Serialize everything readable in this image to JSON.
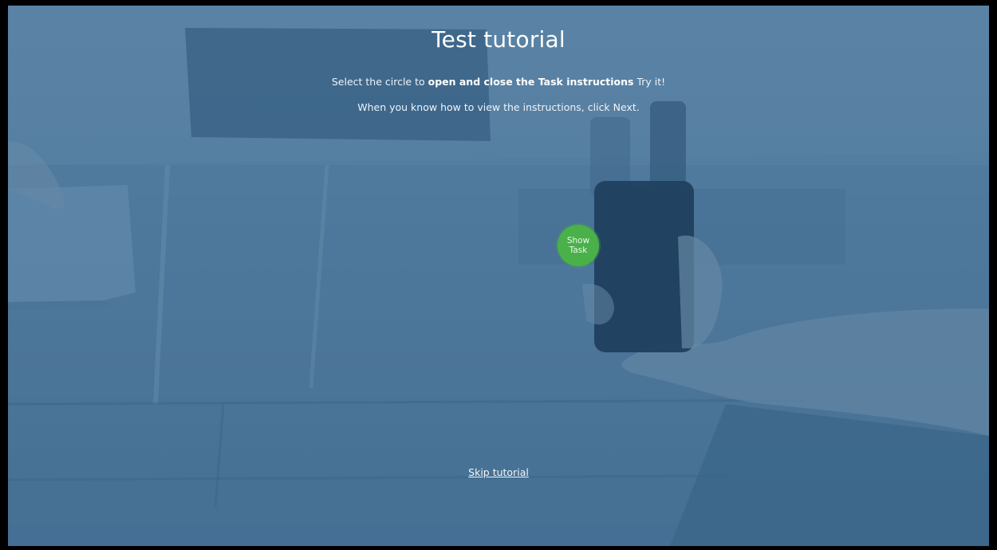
{
  "tutorial": {
    "title": "Test tutorial",
    "line1_prefix": "Select the circle to ",
    "line1_bold": "open and close the Task instructions",
    "line1_suffix": " Try it!",
    "line2": "When you know how to view the instructions, click Next."
  },
  "task_button": {
    "line1": "Show",
    "line2": "Task",
    "color": "#4ab04a"
  },
  "skip_link": {
    "label": "Skip tutorial"
  },
  "colors": {
    "overlay": "#4f7898",
    "text": "#ffffff"
  }
}
